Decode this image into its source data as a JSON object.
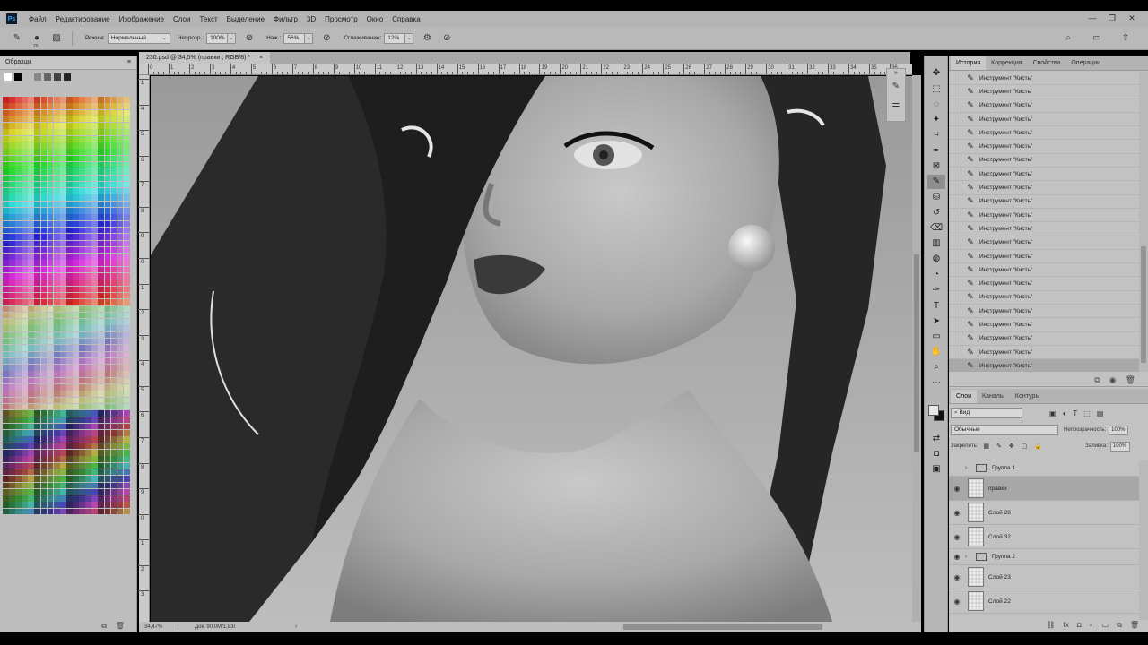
{
  "menu": {
    "logo": "Ps",
    "items": [
      "Файл",
      "Редактирование",
      "Изображение",
      "Слои",
      "Текст",
      "Выделение",
      "Фильтр",
      "3D",
      "Просмотр",
      "Окно",
      "Справка"
    ]
  },
  "window_controls": {
    "minimize": "—",
    "restore": "❐",
    "close": "✕"
  },
  "options_bar": {
    "brush_size": "20",
    "mode_label": "Режим:",
    "mode_value": "Нормальный",
    "opacity_label": "Непрозр.:",
    "opacity_value": "100%",
    "pressure_label": "Наж.:",
    "pressure_value": "56%",
    "smoothing_label": "Сглаживание:",
    "smoothing_value": "12%"
  },
  "swatches": {
    "title": "Образцы",
    "footer_new": "⧉",
    "footer_delete": "🗑"
  },
  "document": {
    "tab_title": "230.psd @ 34,5% (правки , RGB/8) *",
    "tab_close": "×",
    "ruler_h_labels": [
      "0",
      "1",
      "2",
      "3",
      "4",
      "5",
      "6",
      "7",
      "8",
      "9",
      "10",
      "11",
      "12",
      "13",
      "14",
      "15",
      "16",
      "17",
      "18",
      "19",
      "20",
      "21",
      "22",
      "23",
      "24",
      "25",
      "26",
      "27",
      "28",
      "29",
      "30",
      "31",
      "32",
      "33",
      "34",
      "35",
      "36"
    ],
    "ruler_v_labels": [
      "1",
      "4",
      "5",
      "6",
      "7",
      "8",
      "9",
      "0",
      "1",
      "2",
      "3",
      "4",
      "5",
      "6",
      "7",
      "8",
      "9",
      "0",
      "1",
      "2",
      "3"
    ],
    "status_zoom": "34,47%",
    "status_doc": "Док: 90,0M/1,83Г",
    "status_arrow": "›"
  },
  "history": {
    "tabs": [
      "История",
      "Коррекция",
      "Свойства",
      "Операции"
    ],
    "items": [
      "Инструмент \"Кисть\"",
      "Инструмент \"Кисть\"",
      "Инструмент \"Кисть\"",
      "Инструмент \"Кисть\"",
      "Инструмент \"Кисть\"",
      "Инструмент \"Кисть\"",
      "Инструмент \"Кисть\"",
      "Инструмент \"Кисть\"",
      "Инструмент \"Кисть\"",
      "Инструмент \"Кисть\"",
      "Инструмент \"Кисть\"",
      "Инструмент \"Кисть\"",
      "Инструмент \"Кисть\"",
      "Инструмент \"Кисть\"",
      "Инструмент \"Кисть\"",
      "Инструмент \"Кисть\"",
      "Инструмент \"Кисть\"",
      "Инструмент \"Кисть\"",
      "Инструмент \"Кисть\"",
      "Инструмент \"Кисть\"",
      "Инструмент \"Кисть\"",
      "Инструмент \"Кисть\""
    ]
  },
  "layers": {
    "tabs": [
      "Слои",
      "Каналы",
      "Контуры"
    ],
    "filter_value": "Вид",
    "blend_value": "Обычные",
    "opacity_label": "Непрозрачность:",
    "opacity_value": "100%",
    "lock_label": "Закрепить:",
    "fill_label": "Заливка:",
    "fill_value": "100%",
    "items": [
      {
        "name": "Группа 1",
        "type": "group"
      },
      {
        "name": "правки",
        "type": "layer"
      },
      {
        "name": "Слой 28",
        "type": "layer"
      },
      {
        "name": "Слой 32",
        "type": "layer"
      },
      {
        "name": "Группа 2",
        "type": "group"
      },
      {
        "name": "Слой 23",
        "type": "layer"
      },
      {
        "name": "Слой 22",
        "type": "layer"
      }
    ]
  },
  "icons": {
    "tools": [
      "move-icon",
      "marquee-icon",
      "lasso-icon",
      "quick-select-icon",
      "crop-icon",
      "frame-icon",
      "eyedropper-icon",
      "healing-icon",
      "brush-icon",
      "stamp-icon",
      "history-brush-icon",
      "eraser-icon",
      "gradient-icon",
      "blur-icon",
      "dodge-icon",
      "pen-icon",
      "type-icon",
      "path-select-icon",
      "shape-icon",
      "hand-icon",
      "zoom-icon",
      "more-icon"
    ]
  },
  "colors": {
    "foreground": "#e8e8e8",
    "background": "#111111"
  }
}
